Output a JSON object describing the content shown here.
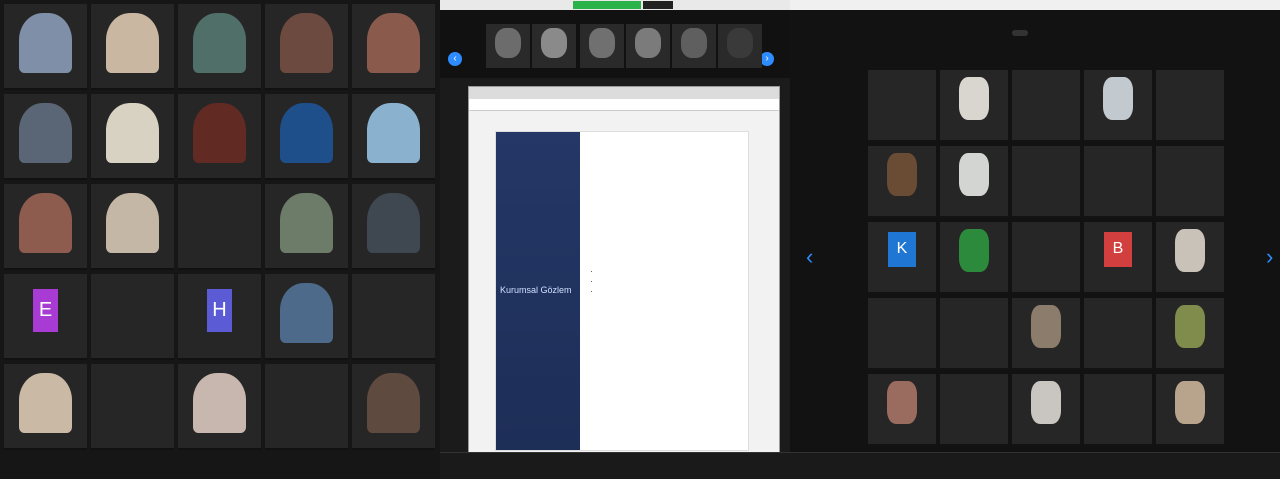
{
  "panel_left": {
    "tiles": [
      {
        "type": "video",
        "color": "#7f8fa8",
        "name": ""
      },
      {
        "type": "video",
        "color": "#c9b7a1",
        "name": ""
      },
      {
        "type": "video",
        "color": "#4f6f68",
        "name": ""
      },
      {
        "type": "video",
        "color": "#6d4a3f",
        "name": ""
      },
      {
        "type": "video",
        "color": "#8a5a4c",
        "name": ""
      },
      {
        "type": "video",
        "color": "#5a6675",
        "name": ""
      },
      {
        "type": "video",
        "color": "#d8d2c2",
        "name": ""
      },
      {
        "type": "video",
        "color": "#612a22",
        "name": ""
      },
      {
        "type": "video",
        "color": "#1e4f8a",
        "name": ""
      },
      {
        "type": "video",
        "color": "#8ab2cf",
        "name": ""
      },
      {
        "type": "video",
        "color": "#8d5c4f",
        "name": ""
      },
      {
        "type": "video",
        "color": "#c4b7a6",
        "name": ""
      },
      {
        "type": "text",
        "text": "",
        "name": ""
      },
      {
        "type": "video",
        "color": "#6c7c68",
        "name": ""
      },
      {
        "type": "video",
        "color": "#3f4750",
        "name": ""
      },
      {
        "type": "avatar",
        "letter": "E",
        "color": "#a83bd3",
        "name": ""
      },
      {
        "type": "text",
        "text": "",
        "name": ""
      },
      {
        "type": "avatar",
        "letter": "H",
        "color": "#5b5bd6",
        "name": ""
      },
      {
        "type": "video",
        "color": "#4d6a8a",
        "name": ""
      },
      {
        "type": "text",
        "text": "",
        "name": ""
      },
      {
        "type": "video",
        "color": "#c9b9a5",
        "name": ""
      },
      {
        "type": "text",
        "text": "",
        "name": ""
      },
      {
        "type": "video",
        "color": "#c7b7ae",
        "name": ""
      },
      {
        "type": "text",
        "text": "",
        "name": ""
      },
      {
        "type": "video",
        "color": "#5f4a3f",
        "name": ""
      }
    ]
  },
  "panel_middle": {
    "top_bar_title": "",
    "share_banner": "",
    "stop_label": "",
    "thumbnails": [
      {
        "color": "#6c6c6c",
        "name": ""
      },
      {
        "color": "#8a8a8a",
        "name": ""
      },
      {
        "color": "#707070",
        "name": ""
      },
      {
        "color": "#7b7b7b",
        "name": ""
      },
      {
        "color": "#5f5f5f",
        "name": ""
      },
      {
        "color": "#3a3a3a",
        "name": ""
      }
    ],
    "browser_tab": "",
    "browser_url": "",
    "slide": {
      "title": "Kurumsal Gözlem",
      "bullets": [
        "",
        "",
        ""
      ]
    },
    "toolbar": [
      {
        "icon": "",
        "label": ""
      },
      {
        "icon": "",
        "label": ""
      },
      {
        "icon": "",
        "label": ""
      },
      {
        "icon": "",
        "label": ""
      },
      {
        "icon": "",
        "label": ""
      },
      {
        "icon": "",
        "label": "",
        "green": true
      },
      {
        "icon": "",
        "label": ""
      },
      {
        "icon": "",
        "label": ""
      },
      {
        "icon": "",
        "label": ""
      },
      {
        "icon": "",
        "label": ""
      },
      {
        "icon": "",
        "label": ""
      },
      {
        "icon": "",
        "label": ""
      }
    ]
  },
  "panel_right": {
    "top_bar_title": "",
    "status_pill": "",
    "tiles": [
      {
        "type": "text",
        "text": "",
        "name": ""
      },
      {
        "type": "video",
        "color": "#d9d6d0",
        "name": ""
      },
      {
        "type": "text",
        "text": "",
        "name": ""
      },
      {
        "type": "video",
        "color": "#c2c9cf",
        "name": ""
      },
      {
        "type": "text",
        "text": "",
        "name": ""
      },
      {
        "type": "video",
        "color": "#6a4b34",
        "name": ""
      },
      {
        "type": "video",
        "color": "#d3d5d2",
        "name": ""
      },
      {
        "type": "text",
        "text": "",
        "name": ""
      },
      {
        "type": "text",
        "text": "",
        "name": ""
      },
      {
        "type": "text",
        "text": "",
        "name": ""
      },
      {
        "type": "avatar",
        "letter": "K",
        "color": "#1f76d3",
        "name": ""
      },
      {
        "type": "video",
        "color": "#2c8a3d",
        "name": ""
      },
      {
        "type": "text",
        "text": "",
        "name": ""
      },
      {
        "type": "avatar",
        "letter": "B",
        "color": "#d13f3f",
        "name": ""
      },
      {
        "type": "video",
        "color": "#c9c2b8",
        "name": ""
      },
      {
        "type": "text",
        "text": "",
        "name": ""
      },
      {
        "type": "text",
        "text": "",
        "name": ""
      },
      {
        "type": "video",
        "color": "#8c7c6c",
        "name": ""
      },
      {
        "type": "text",
        "text": "",
        "name": ""
      },
      {
        "type": "video",
        "color": "#7f8c4c",
        "name": ""
      },
      {
        "type": "video",
        "color": "#9a6b5f",
        "name": ""
      },
      {
        "type": "text",
        "text": "",
        "name": ""
      },
      {
        "type": "video",
        "color": "#c9c6c2",
        "name": ""
      },
      {
        "type": "text",
        "text": "",
        "name": ""
      },
      {
        "type": "video",
        "color": "#b8a48d",
        "name": ""
      }
    ],
    "toolbar": [
      {
        "icon": "",
        "label": ""
      },
      {
        "icon": "",
        "label": ""
      },
      {
        "icon": "",
        "label": ""
      },
      {
        "icon": "",
        "label": ""
      },
      {
        "icon": "",
        "label": "",
        "green": true
      },
      {
        "icon": "",
        "label": ""
      },
      {
        "icon": "",
        "label": ""
      },
      {
        "icon": "",
        "label": ""
      },
      {
        "icon": "",
        "label": ""
      },
      {
        "icon": "",
        "label": ""
      },
      {
        "icon": "",
        "label": ""
      },
      {
        "icon": "",
        "label": ""
      }
    ]
  }
}
